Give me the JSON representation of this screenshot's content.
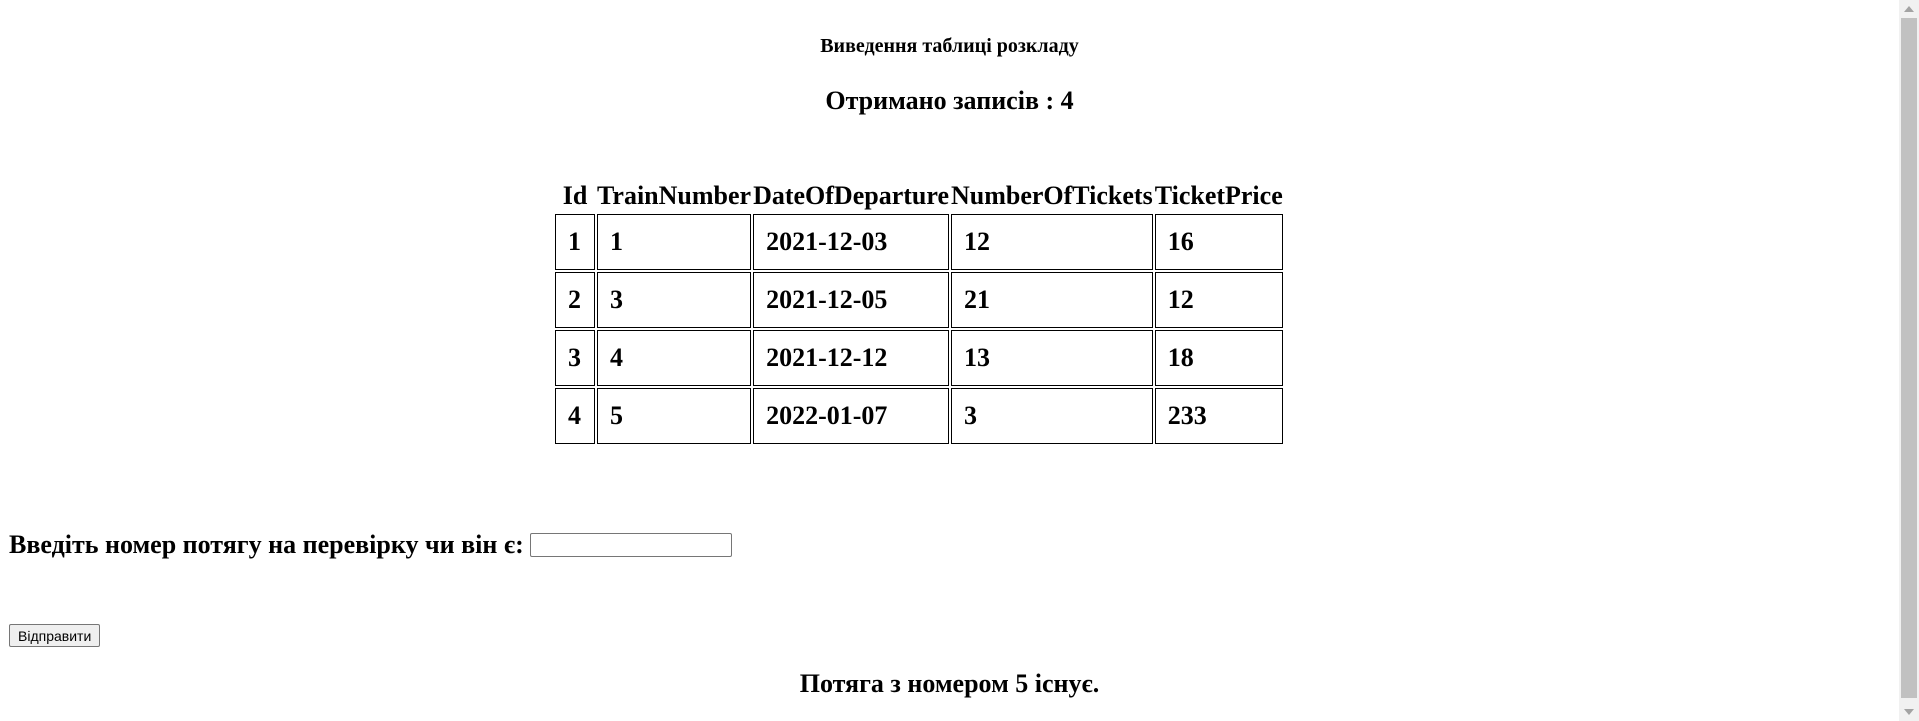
{
  "header": {
    "title": "Виведення таблиці розкладу",
    "record_count_text": "Отримано записів : 4"
  },
  "table": {
    "columns": [
      "Id",
      "TrainNumber",
      "DateOfDeparture",
      "NumberOfTickets",
      "TicketPrice"
    ],
    "rows": [
      [
        "1",
        "1",
        "2021-12-03",
        "12",
        "16"
      ],
      [
        "2",
        "3",
        "2021-12-05",
        "21",
        "12"
      ],
      [
        "3",
        "4",
        "2021-12-12",
        "13",
        "18"
      ],
      [
        "4",
        "5",
        "2022-01-07",
        "3",
        "233"
      ]
    ]
  },
  "form": {
    "label": "Введіть номер потягу на перевірку чи він є:",
    "input_value": "",
    "submit_label": "Відправити"
  },
  "result": {
    "message": "Потяга з номером 5 існує."
  }
}
